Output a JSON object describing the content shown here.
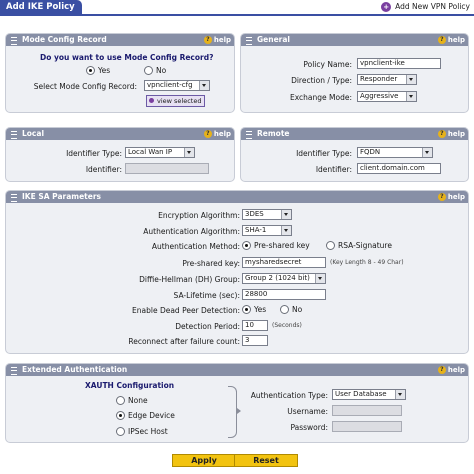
{
  "header": {
    "title": "Add IKE Policy",
    "add_link": "Add New VPN Policy"
  },
  "help_label": "help",
  "mode_config": {
    "title": "Mode Config Record",
    "question": "Do you want to use Mode Config Record?",
    "yes": "Yes",
    "no": "No",
    "select_label": "Select Mode Config Record:",
    "select_value": "vpnclient-cfg",
    "view_button": "view selected"
  },
  "general": {
    "title": "General",
    "policy_name_label": "Policy Name:",
    "policy_name_value": "vpnclient-ike",
    "direction_label": "Direction / Type:",
    "direction_value": "Responder",
    "exchange_label": "Exchange Mode:",
    "exchange_value": "Aggressive"
  },
  "local": {
    "title": "Local",
    "id_type_label": "Identifier Type:",
    "id_type_value": "Local Wan IP",
    "identifier_label": "Identifier:",
    "identifier_value": ""
  },
  "remote": {
    "title": "Remote",
    "id_type_label": "Identifier Type:",
    "id_type_value": "FQDN",
    "identifier_label": "Identifier:",
    "identifier_value": "client.domain.com"
  },
  "ike_sa": {
    "title": "IKE SA Parameters",
    "enc_label": "Encryption Algorithm:",
    "enc_value": "3DES",
    "auth_alg_label": "Authentication Algorithm:",
    "auth_alg_value": "SHA-1",
    "auth_method_label": "Authentication Method:",
    "auth_method_psk": "Pre-shared key",
    "auth_method_rsa": "RSA-Signature",
    "psk_label": "Pre-shared key:",
    "psk_value": "mysharedsecret",
    "psk_note": "(Key Length 8 - 49 Char)",
    "dh_label": "Diffie-Hellman (DH) Group:",
    "dh_value": "Group 2 (1024 bit)",
    "lifetime_label": "SA-Lifetime (sec):",
    "lifetime_value": "28800",
    "dpd_label": "Enable Dead Peer Detection:",
    "dpd_yes": "Yes",
    "dpd_no": "No",
    "period_label": "Detection Period:",
    "period_value": "10",
    "period_note": "(Seconds)",
    "reconnect_label": "Reconnect after failure count:",
    "reconnect_value": "3"
  },
  "xauth": {
    "title": "Extended Authentication",
    "config_title": "XAUTH Configuration",
    "opt_none": "None",
    "opt_edge": "Edge Device",
    "opt_ipsec": "IPSec Host",
    "auth_type_label": "Authentication Type:",
    "auth_type_value": "User Database",
    "username_label": "Username:",
    "username_value": "",
    "password_label": "Password:",
    "password_value": ""
  },
  "actions": {
    "apply": "Apply",
    "reset": "Reset"
  }
}
